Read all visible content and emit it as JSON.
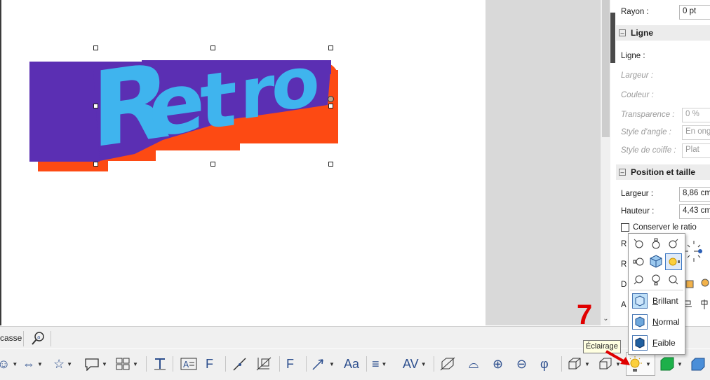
{
  "canvas": {
    "text_art": "Retro",
    "colors": {
      "face": "#3fb4ee",
      "extrusion": "#5b2fb3",
      "shadow": "#fd4a13"
    }
  },
  "sidebar": {
    "rayon": {
      "label": "Rayon :",
      "value": "0 pt"
    },
    "ligne_section": {
      "title": "Ligne",
      "toggle": "⊟"
    },
    "ligne": {
      "ligne_label": "Ligne :",
      "largeur_label": "Largeur :",
      "couleur_label": "Couleur :",
      "transparence": {
        "label": "Transparence :",
        "value": "0 %"
      },
      "style_angle": {
        "label": "Style d'angle :",
        "value": "En onglet"
      },
      "style_coiffe": {
        "label": "Style de coiffe :",
        "value": "Plat"
      }
    },
    "position_section": {
      "title": "Position et taille",
      "toggle": "⊟"
    },
    "position": {
      "largeur": {
        "label": "Largeur :",
        "value": "8,86 cm"
      },
      "hauteur": {
        "label": "Hauteur :",
        "value": "4,43 cm"
      },
      "conserver_ratio": "Conserver le ratio",
      "partial_labels": [
        "R",
        "R",
        "D",
        "A"
      ]
    }
  },
  "find_toolbar": {
    "case_label": "casse"
  },
  "lighting_popup": {
    "selected_light": 5,
    "options": [
      {
        "label": "Brillant",
        "accel": "B",
        "rest": "rillant"
      },
      {
        "label": "Normal",
        "accel": "N",
        "rest": "ormal"
      },
      {
        "label": "Faible",
        "accel": "F",
        "rest": "aible"
      }
    ]
  },
  "tooltip": "Éclairage",
  "annotation": {
    "step": "7",
    "color": "#e00000"
  },
  "draw_toolbar": {
    "icons": [
      "smiley-icon",
      "double-arrow-icon",
      "star-icon",
      "callout-icon",
      "flowchart-icon",
      "text-icon",
      "textbox-icon",
      "fontwork-icon",
      "curve-icon",
      "crop-icon",
      "fontwork2-icon",
      "line-arrow-icon",
      "text-size-icon",
      "align-icon",
      "spacing-icon",
      "toggle-extrusion-icon",
      "tilt-down-icon",
      "tilt-up-icon",
      "tilt-left-icon",
      "tilt-right-icon",
      "depth-icon",
      "direction-icon",
      "lighting-icon",
      "surface-icon",
      "3d-color-icon"
    ]
  }
}
